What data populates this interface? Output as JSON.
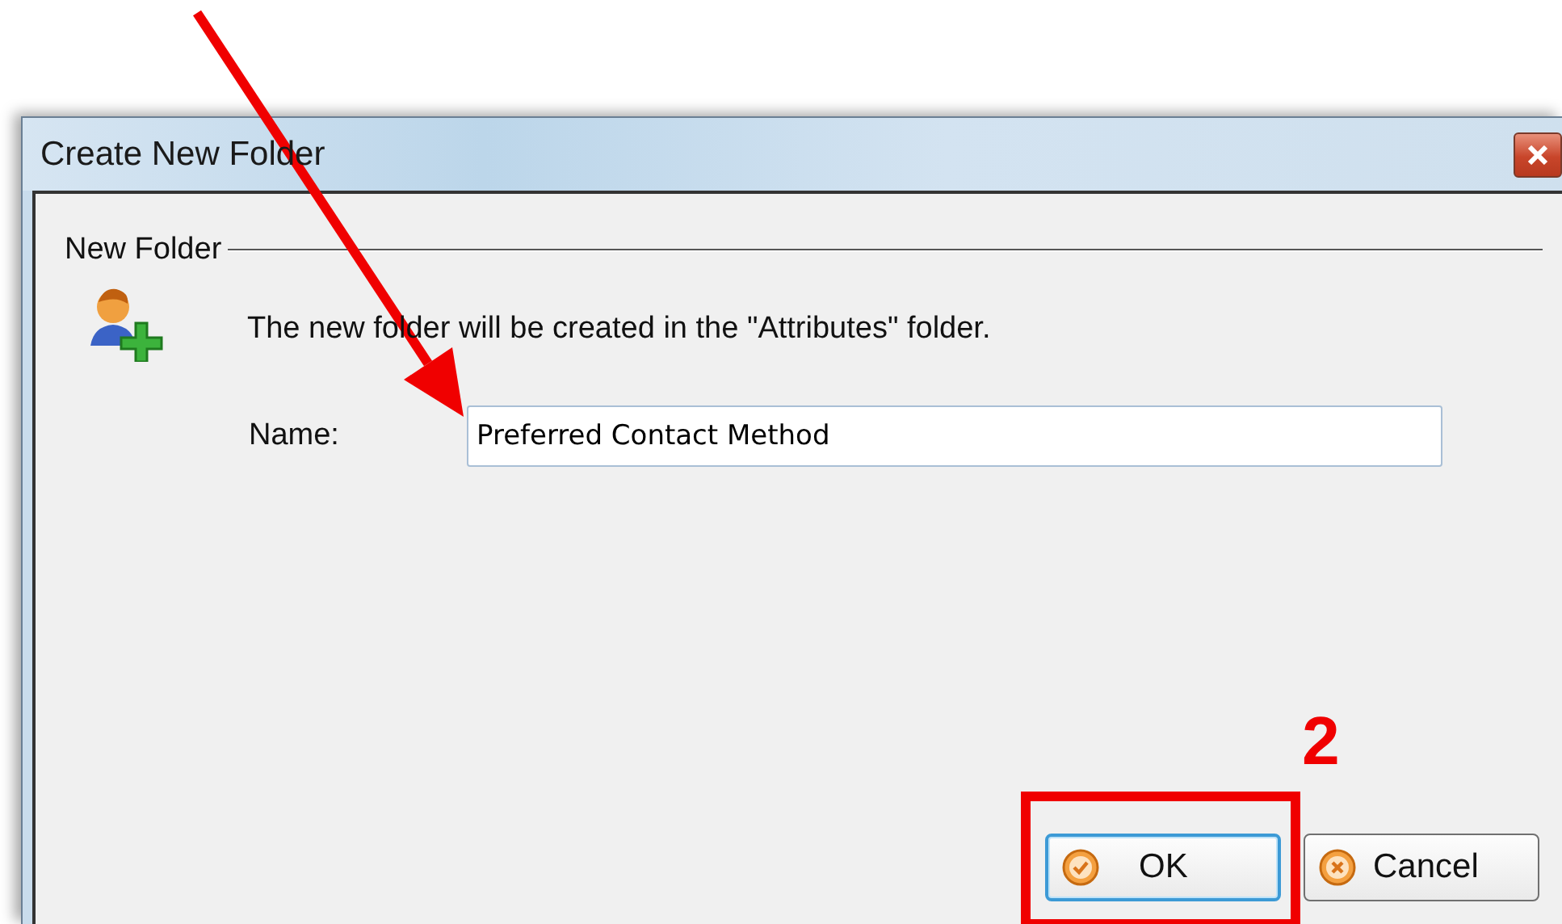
{
  "window": {
    "title": "Create New Folder"
  },
  "group": {
    "title": "New Folder"
  },
  "message": "The new folder will be created in the \"Attributes\" folder.",
  "name_field": {
    "label": "Name:",
    "value": "Preferred Contact Method"
  },
  "buttons": [
    {
      "label": "OK",
      "kind": "ok",
      "default": true
    },
    {
      "label": "Cancel",
      "kind": "cancel",
      "default": false
    }
  ],
  "annotation": {
    "step": "2"
  }
}
